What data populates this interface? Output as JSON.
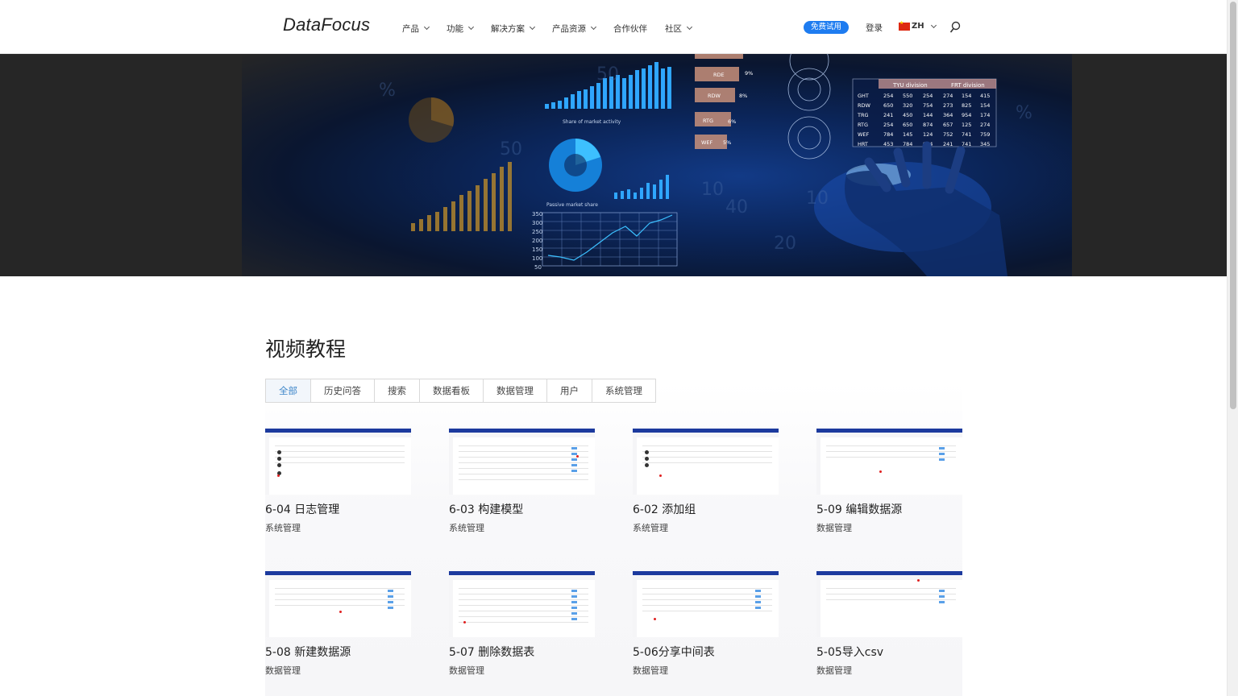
{
  "header": {
    "logo": "DataFocus",
    "nav": [
      {
        "label": "产品",
        "has_dropdown": true
      },
      {
        "label": "功能",
        "has_dropdown": true
      },
      {
        "label": "解决方案",
        "has_dropdown": true
      },
      {
        "label": "产品资源",
        "has_dropdown": true
      },
      {
        "label": "合作伙伴",
        "has_dropdown": false
      },
      {
        "label": "社区",
        "has_dropdown": true
      }
    ],
    "trial_label": "免费试用",
    "login_label": "登录",
    "lang_label": "ZH",
    "search_icon": "search-icon"
  },
  "hero": {
    "image": "analytics-dashboard-banner-with-hand",
    "chart_labels": [
      "TYU division",
      "FRT division"
    ],
    "table_rows": [
      [
        "GHT",
        "254",
        "550",
        "254",
        "274",
        "154",
        "415"
      ],
      [
        "RDW",
        "650",
        "320",
        "754",
        "273",
        "825",
        "154"
      ],
      [
        "TRG",
        "241",
        "450",
        "144",
        "364",
        "954",
        "174"
      ],
      [
        "RTG",
        "254",
        "650",
        "874",
        "657",
        "125",
        "274"
      ],
      [
        "WEF",
        "784",
        "145",
        "124",
        "752",
        "741",
        "759"
      ],
      [
        "HRT",
        "453",
        "784",
        "954",
        "241",
        "741",
        "345"
      ]
    ],
    "side_labels": [
      "RDE",
      "RDW",
      "RTG",
      "WEF"
    ],
    "side_pcts": [
      "9%",
      "8%",
      "6%",
      "5%"
    ],
    "y_ticks": [
      "350",
      "300",
      "250",
      "200",
      "150",
      "100",
      "50"
    ],
    "small_caption": "Share of market activity",
    "small_caption2": "Passive market share"
  },
  "main": {
    "title": "视频教程",
    "tabs": [
      {
        "label": "全部",
        "active": true
      },
      {
        "label": "历史问答",
        "active": false
      },
      {
        "label": "搜索",
        "active": false
      },
      {
        "label": "数据看板",
        "active": false
      },
      {
        "label": "数据管理",
        "active": false
      },
      {
        "label": "用户",
        "active": false
      },
      {
        "label": "系统管理",
        "active": false
      }
    ],
    "videos": [
      {
        "title": "6-04 日志管理",
        "category": "系统管理"
      },
      {
        "title": "6-03 构建模型",
        "category": "系统管理"
      },
      {
        "title": "6-02 添加组",
        "category": "系统管理"
      },
      {
        "title": "5-09 编辑数据源",
        "category": "数据管理"
      },
      {
        "title": "5-08 新建数据源",
        "category": "数据管理"
      },
      {
        "title": "5-07 删除数据表",
        "category": "数据管理"
      },
      {
        "title": "5-06分享中间表",
        "category": "数据管理"
      },
      {
        "title": "5-05导入csv",
        "category": "数据管理"
      }
    ]
  },
  "colors": {
    "brand_blue": "#1e7cf0",
    "active_tab": "#3c85c9",
    "thumb_header": "#1c3a9e"
  }
}
